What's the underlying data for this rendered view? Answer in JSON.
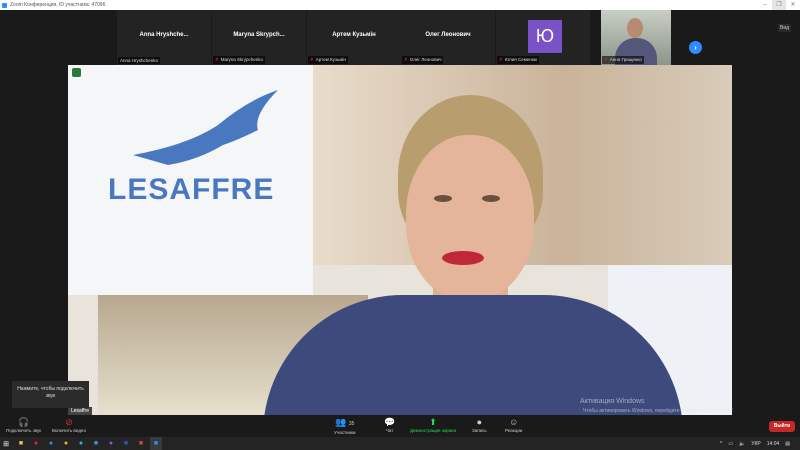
{
  "window": {
    "title": "Zoom Конференция, ID участника: 47096",
    "view_label": "Вид"
  },
  "thumbnails": [
    {
      "display": "Anna Hryshche...",
      "label": "Anna Hryshchenko",
      "muted": false
    },
    {
      "display": "Maryna Skrypch...",
      "label": "Maryna Skrypchenko",
      "muted": true
    },
    {
      "display": "Артем Кузьмін",
      "label": "Артем Кузьмін",
      "muted": true
    },
    {
      "display": "Олег Леонович",
      "label": "Олег Леонович",
      "muted": true
    },
    {
      "display": "Ю",
      "label": "Юлия Семенюк",
      "muted": true
    },
    {
      "display": "",
      "label": "Анна Грищенко",
      "muted": true
    }
  ],
  "main_video": {
    "logo": "LESAFFRE",
    "name_tag": "Lesaffre"
  },
  "tooltip": "Нажмите, чтобы подключить звук",
  "watermark": {
    "title": "Активация Windows",
    "subtitle": "Чтобы активировать Windows, перейдите в раздел \"Параметры\"."
  },
  "toolbar": {
    "audio": "Подключить звук",
    "video": "Включить видео",
    "participants": "Участники",
    "participants_count": "35",
    "chat": "Чат",
    "share": "Демонстрация экрана",
    "record": "Запись",
    "reactions": "Реакции",
    "leave": "Выйти"
  },
  "taskbar": {
    "lang": "УКР",
    "time": "14:04"
  },
  "colors": {
    "accent": "#2d8cff",
    "leave": "#c62828",
    "share": "#23d959"
  }
}
